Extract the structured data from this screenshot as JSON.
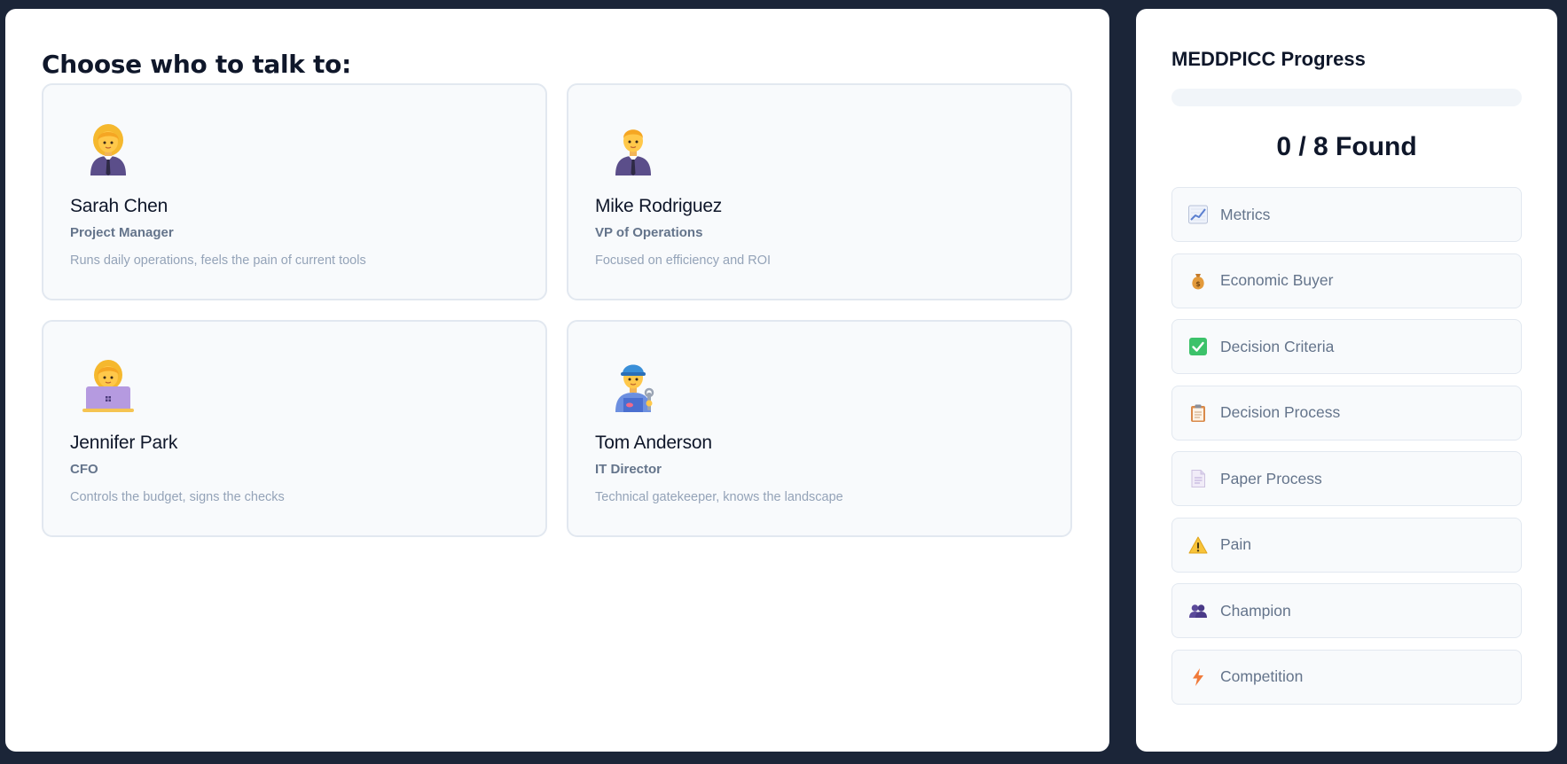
{
  "main": {
    "title": "Choose who to talk to:",
    "contacts": [
      {
        "name": "Sarah Chen",
        "role": "Project Manager",
        "description": "Runs daily operations, feels the pain of current tools",
        "avatar": "woman-office-worker-icon"
      },
      {
        "name": "Mike Rodriguez",
        "role": "VP of Operations",
        "description": "Focused on efficiency and ROI",
        "avatar": "man-office-worker-icon"
      },
      {
        "name": "Jennifer Park",
        "role": "CFO",
        "description": "Controls the budget, signs the checks",
        "avatar": "woman-technologist-icon"
      },
      {
        "name": "Tom Anderson",
        "role": "IT Director",
        "description": "Technical gatekeeper, knows the landscape",
        "avatar": "man-mechanic-icon"
      }
    ]
  },
  "sidebar": {
    "title": "MEDDPICC Progress",
    "progress_percent": 0,
    "found_label": "0 / 8 Found",
    "criteria": [
      {
        "label": "Metrics",
        "icon": "chart-increasing-icon"
      },
      {
        "label": "Economic Buyer",
        "icon": "money-bag-icon"
      },
      {
        "label": "Decision Criteria",
        "icon": "check-mark-icon"
      },
      {
        "label": "Decision Process",
        "icon": "clipboard-icon"
      },
      {
        "label": "Paper Process",
        "icon": "page-icon"
      },
      {
        "label": "Pain",
        "icon": "warning-icon"
      },
      {
        "label": "Champion",
        "icon": "people-icon"
      },
      {
        "label": "Competition",
        "icon": "lightning-icon"
      }
    ]
  },
  "colors": {
    "page_background": "#1b2538",
    "panel_background": "#ffffff",
    "card_background": "#f8fafc",
    "card_border": "#e2e8f0",
    "heading_text": "#0f172a",
    "role_text": "#64748b",
    "description_text": "#94a3b8",
    "progress_track": "#f1f5f9"
  }
}
